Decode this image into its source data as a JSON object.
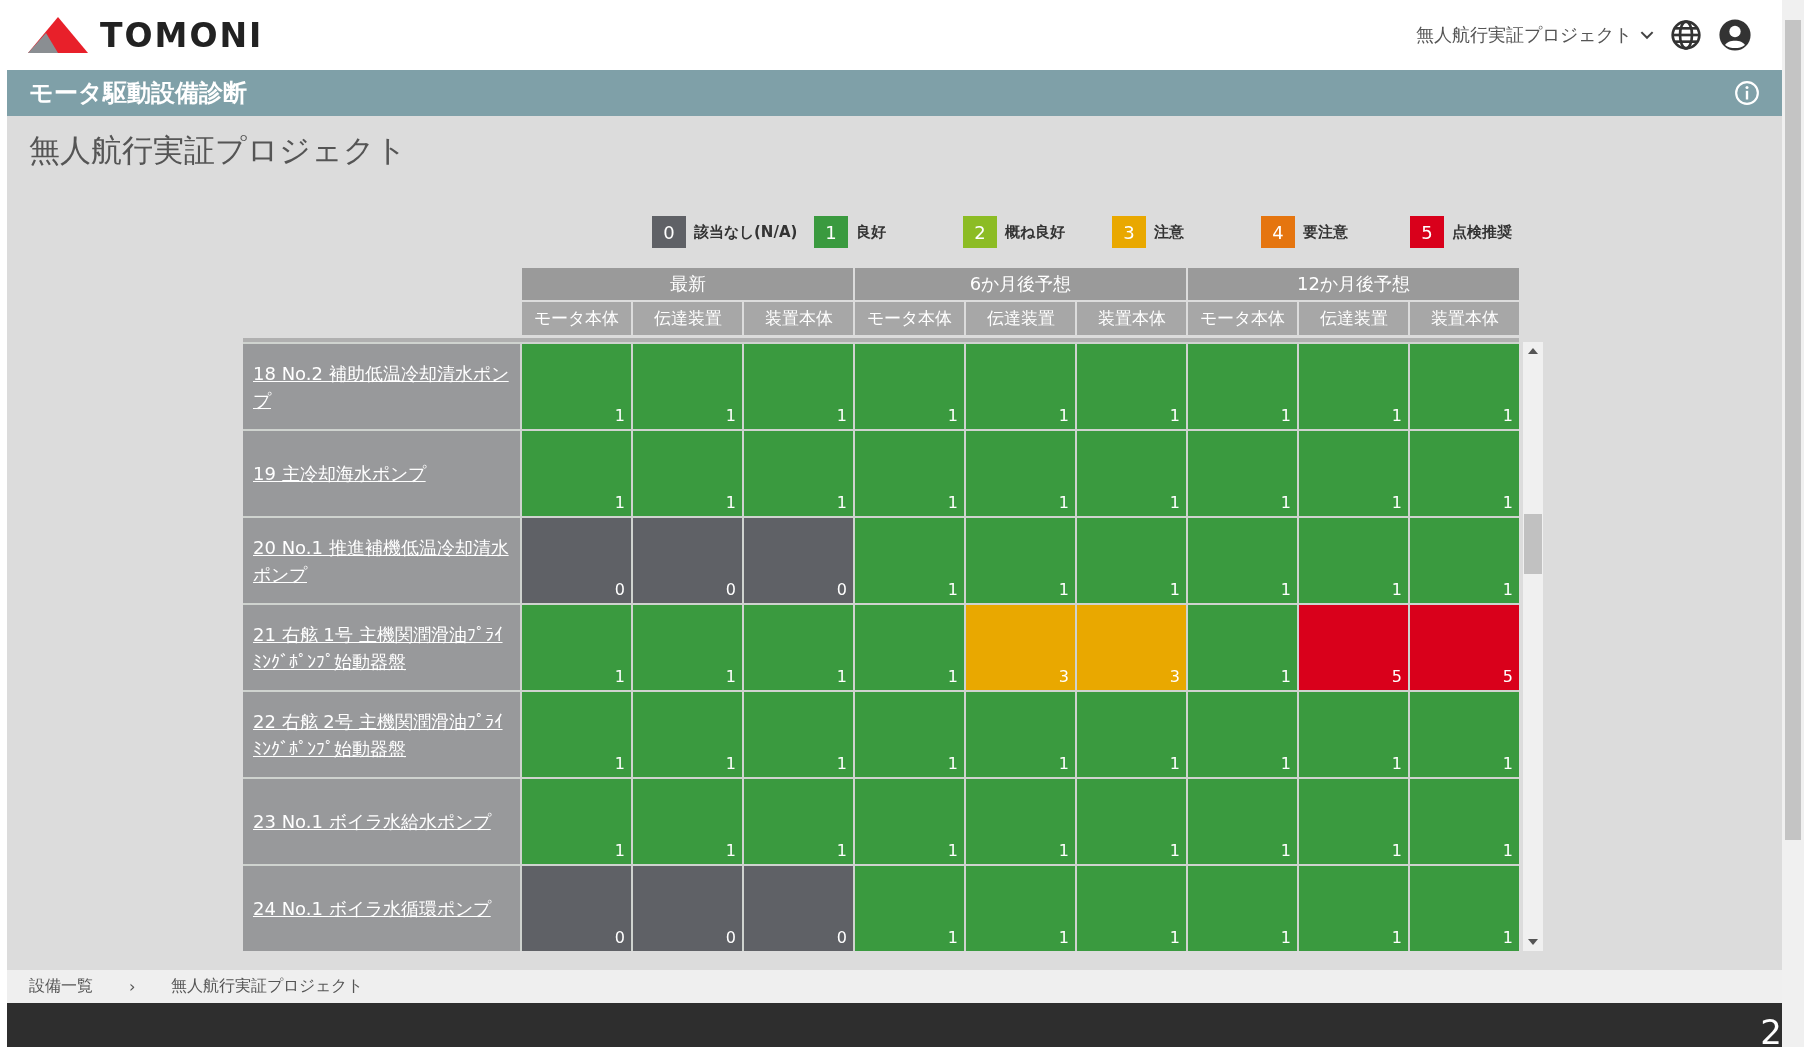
{
  "header": {
    "logo_text": "TOMONI",
    "project_menu": "無人航行実証プロジェクト"
  },
  "title_bar": {
    "title": "モータ駆動設備診断"
  },
  "page_title": "無人航行実証プロジェクト",
  "legend": [
    {
      "value": "0",
      "label": "該当なし(N/A)",
      "color": "#5f6166"
    },
    {
      "value": "1",
      "label": "良好",
      "color": "#3a9a3f"
    },
    {
      "value": "2",
      "label": "概ね良好",
      "color": "#8cbc24"
    },
    {
      "value": "3",
      "label": "注意",
      "color": "#e9a800"
    },
    {
      "value": "4",
      "label": "要注意",
      "color": "#e5750f"
    },
    {
      "value": "5",
      "label": "点検推奨",
      "color": "#d9001b"
    }
  ],
  "table": {
    "groups": [
      "最新",
      "6か月後予想",
      "12か月後予想"
    ],
    "columns": [
      "モータ本体",
      "伝達装置",
      "装置本体",
      "モータ本体",
      "伝達装置",
      "装置本体",
      "モータ本体",
      "伝達装置",
      "装置本体"
    ],
    "rows": [
      {
        "name": "18 No.2 補助低温冷却清水ポンプ",
        "cells": [
          {
            "value": "1",
            "color": "#3a9a3f"
          },
          {
            "value": "1",
            "color": "#3a9a3f"
          },
          {
            "value": "1",
            "color": "#3a9a3f"
          },
          {
            "value": "1",
            "color": "#3a9a3f"
          },
          {
            "value": "1",
            "color": "#3a9a3f"
          },
          {
            "value": "1",
            "color": "#3a9a3f"
          },
          {
            "value": "1",
            "color": "#3a9a3f"
          },
          {
            "value": "1",
            "color": "#3a9a3f"
          },
          {
            "value": "1",
            "color": "#3a9a3f"
          }
        ]
      },
      {
        "name": "19 主冷却海水ポンプ",
        "cells": [
          {
            "value": "1",
            "color": "#3a9a3f"
          },
          {
            "value": "1",
            "color": "#3a9a3f"
          },
          {
            "value": "1",
            "color": "#3a9a3f"
          },
          {
            "value": "1",
            "color": "#3a9a3f"
          },
          {
            "value": "1",
            "color": "#3a9a3f"
          },
          {
            "value": "1",
            "color": "#3a9a3f"
          },
          {
            "value": "1",
            "color": "#3a9a3f"
          },
          {
            "value": "1",
            "color": "#3a9a3f"
          },
          {
            "value": "1",
            "color": "#3a9a3f"
          }
        ]
      },
      {
        "name": "20 No.1 推進補機低温冷却清水ポンプ",
        "cells": [
          {
            "value": "0",
            "color": "#5f6166"
          },
          {
            "value": "0",
            "color": "#5f6166"
          },
          {
            "value": "0",
            "color": "#5f6166"
          },
          {
            "value": "1",
            "color": "#3a9a3f"
          },
          {
            "value": "1",
            "color": "#3a9a3f"
          },
          {
            "value": "1",
            "color": "#3a9a3f"
          },
          {
            "value": "1",
            "color": "#3a9a3f"
          },
          {
            "value": "1",
            "color": "#3a9a3f"
          },
          {
            "value": "1",
            "color": "#3a9a3f"
          }
        ]
      },
      {
        "name": "21 右舷 1号 主機関潤滑油ﾌﾟﾗｲﾐﾝｸﾞﾎﾟﾝﾌﾟ始動器盤",
        "cells": [
          {
            "value": "1",
            "color": "#3a9a3f"
          },
          {
            "value": "1",
            "color": "#3a9a3f"
          },
          {
            "value": "1",
            "color": "#3a9a3f"
          },
          {
            "value": "1",
            "color": "#3a9a3f"
          },
          {
            "value": "3",
            "color": "#e9a800"
          },
          {
            "value": "3",
            "color": "#e9a800"
          },
          {
            "value": "1",
            "color": "#3a9a3f"
          },
          {
            "value": "5",
            "color": "#d9001b"
          },
          {
            "value": "5",
            "color": "#d9001b"
          }
        ]
      },
      {
        "name": "22 右舷 2号 主機関潤滑油ﾌﾟﾗｲﾐﾝｸﾞﾎﾟﾝﾌﾟ始動器盤",
        "cells": [
          {
            "value": "1",
            "color": "#3a9a3f"
          },
          {
            "value": "1",
            "color": "#3a9a3f"
          },
          {
            "value": "1",
            "color": "#3a9a3f"
          },
          {
            "value": "1",
            "color": "#3a9a3f"
          },
          {
            "value": "1",
            "color": "#3a9a3f"
          },
          {
            "value": "1",
            "color": "#3a9a3f"
          },
          {
            "value": "1",
            "color": "#3a9a3f"
          },
          {
            "value": "1",
            "color": "#3a9a3f"
          },
          {
            "value": "1",
            "color": "#3a9a3f"
          }
        ]
      },
      {
        "name": "23 No.1 ボイラ水給水ポンプ",
        "cells": [
          {
            "value": "1",
            "color": "#3a9a3f"
          },
          {
            "value": "1",
            "color": "#3a9a3f"
          },
          {
            "value": "1",
            "color": "#3a9a3f"
          },
          {
            "value": "1",
            "color": "#3a9a3f"
          },
          {
            "value": "1",
            "color": "#3a9a3f"
          },
          {
            "value": "1",
            "color": "#3a9a3f"
          },
          {
            "value": "1",
            "color": "#3a9a3f"
          },
          {
            "value": "1",
            "color": "#3a9a3f"
          },
          {
            "value": "1",
            "color": "#3a9a3f"
          }
        ]
      },
      {
        "name": "24 No.1 ボイラ水循環ポンプ",
        "cells": [
          {
            "value": "0",
            "color": "#5f6166"
          },
          {
            "value": "0",
            "color": "#5f6166"
          },
          {
            "value": "0",
            "color": "#5f6166"
          },
          {
            "value": "1",
            "color": "#3a9a3f"
          },
          {
            "value": "1",
            "color": "#3a9a3f"
          },
          {
            "value": "1",
            "color": "#3a9a3f"
          },
          {
            "value": "1",
            "color": "#3a9a3f"
          },
          {
            "value": "1",
            "color": "#3a9a3f"
          },
          {
            "value": "1",
            "color": "#3a9a3f"
          }
        ]
      }
    ]
  },
  "breadcrumb": [
    {
      "label": "設備一覧"
    },
    {
      "label": "›"
    },
    {
      "label": "無人航行実証プロジェクト"
    }
  ],
  "footer": {
    "text": "2"
  }
}
